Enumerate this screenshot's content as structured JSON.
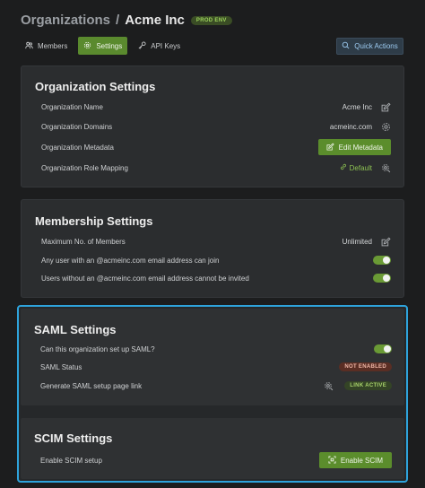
{
  "header": {
    "breadcrumb_root": "Organizations",
    "separator": "/",
    "org_name": "Acme Inc",
    "env_badge": "PROD ENV"
  },
  "tabs": [
    {
      "label": "Members",
      "icon": "users-icon"
    },
    {
      "label": "Settings",
      "icon": "gear-icon",
      "active": true
    },
    {
      "label": "API Keys",
      "icon": "key-icon"
    }
  ],
  "quick_actions_label": "Quick Actions",
  "org_settings": {
    "title": "Organization Settings",
    "name_label": "Organization Name",
    "name_value": "Acme Inc",
    "domains_label": "Organization Domains",
    "domains_value": "acmeinc.com",
    "metadata_label": "Organization Metadata",
    "metadata_button": "Edit Metadata",
    "role_label": "Organization Role Mapping",
    "role_value": "Default"
  },
  "membership_settings": {
    "title": "Membership Settings",
    "max_members_label": "Maximum No. of Members",
    "max_members_value": "Unlimited",
    "join_label": "Any user with an @acmeinc.com email address can join",
    "join_enabled": true,
    "invite_label": "Users without an @acmeinc.com email address cannot be invited",
    "invite_enabled": true
  },
  "saml_settings": {
    "title": "SAML Settings",
    "setup_label": "Can this organization set up SAML?",
    "setup_enabled": true,
    "status_label": "SAML Status",
    "status_badge": "NOT ENABLED",
    "link_label": "Generate SAML setup page link",
    "link_badge": "LINK ACTIVE"
  },
  "scim_settings": {
    "title": "SCIM Settings",
    "setup_label": "Enable SCIM setup",
    "button_label": "Enable SCIM"
  },
  "colors": {
    "accent_green": "#5b8d2c",
    "highlight_blue": "#2ea3dc",
    "background": "#1c1d1e"
  }
}
